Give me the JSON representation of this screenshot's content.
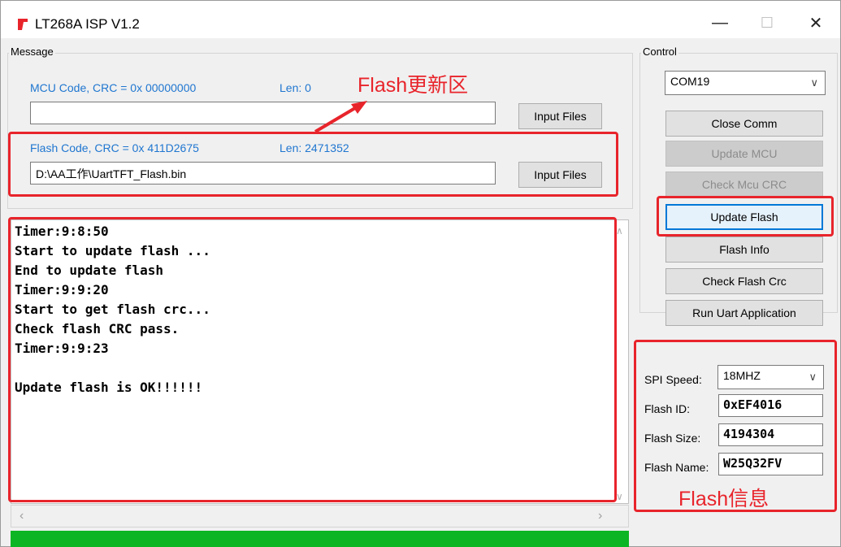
{
  "window": {
    "title": "LT268A ISP V1.2",
    "icon": "app-logo-icon",
    "controls": {
      "minimize": "—",
      "maximize": "☐",
      "close": "✕"
    }
  },
  "message": {
    "group_label": "Message",
    "mcu": {
      "label": "MCU Code, CRC = 0x 00000000",
      "len_label": "Len:  0",
      "path": "",
      "button": "Input Files"
    },
    "flash": {
      "label": "Flash Code, CRC = 0x 411D2675",
      "len_label": "Len:  2471352",
      "path": "D:\\AA工作\\UartTFT_Flash.bin",
      "button": "Input Files"
    }
  },
  "log": {
    "lines": [
      "Timer:9:8:50",
      "Start to update flash ...",
      "End to update flash",
      "Timer:9:9:20",
      "Start to get flash crc...",
      "Check flash CRC pass.",
      "Timer:9:9:23",
      "",
      "Update flash is OK!!!!!!"
    ]
  },
  "control": {
    "group_label": "Control",
    "port": "COM19",
    "buttons": {
      "close_comm": "Close Comm",
      "update_mcu": "Update MCU",
      "check_mcu_crc": "Check Mcu CRC",
      "update_flash": "Update Flash",
      "flash_info": "Flash Info",
      "check_flash_crc": "Check Flash Crc",
      "run_uart": "Run Uart Application"
    },
    "spi_speed_label": "SPI Speed:",
    "spi_speed": "18MHZ",
    "flash_id_label": "Flash ID:",
    "flash_id": "0xEF4016",
    "flash_size_label": "Flash Size:",
    "flash_size": "4194304",
    "flash_name_label": "Flash Name:",
    "flash_name": "W25Q32FV"
  },
  "annotations": {
    "flash_update_area": "Flash更新区",
    "flash_info": "Flash信息"
  },
  "colors": {
    "accent_blue": "#1f76d0",
    "annotation_red": "#e8242b",
    "progress_green": "#0cb523"
  },
  "progress": {
    "fraction": 1.0
  }
}
